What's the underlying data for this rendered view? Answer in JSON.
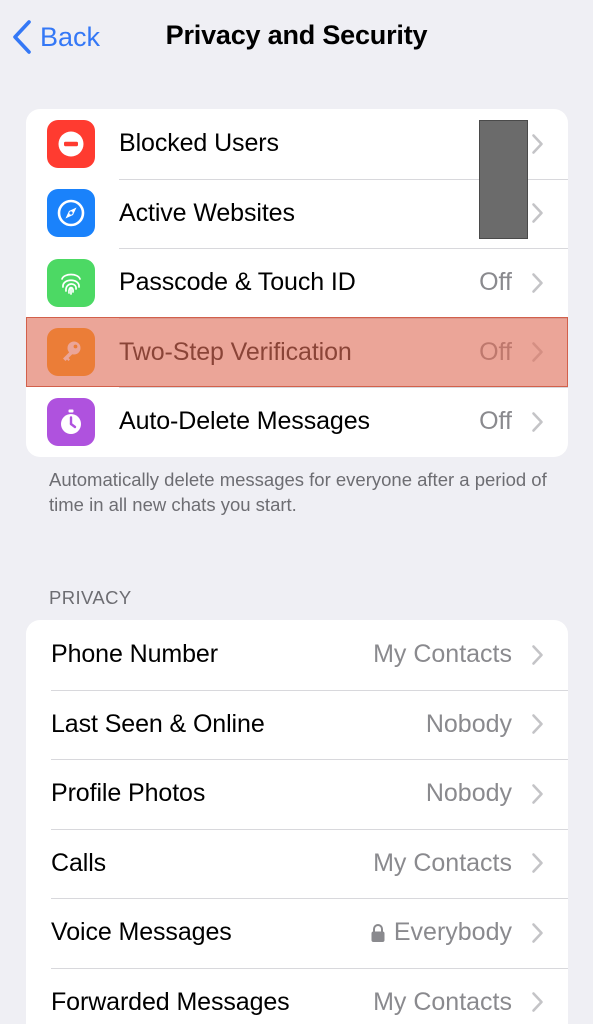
{
  "nav": {
    "back_label": "Back",
    "title": "Privacy and Security"
  },
  "security": {
    "items": [
      {
        "label": "Blocked Users",
        "value": "",
        "icon": "minus-circle-icon",
        "color": "#ff3b30"
      },
      {
        "label": "Active Websites",
        "value": "",
        "icon": "compass-icon",
        "color": "#1a82fb"
      },
      {
        "label": "Passcode & Touch ID",
        "value": "Off",
        "icon": "fingerprint-icon",
        "color": "#4cd964"
      },
      {
        "label": "Two-Step Verification",
        "value": "Off",
        "icon": "key-icon",
        "color": "#ff9500"
      },
      {
        "label": "Auto-Delete Messages",
        "value": "Off",
        "icon": "timer-icon",
        "color": "#af52de"
      }
    ],
    "footnote": "Automatically delete messages for everyone after a period of time in all new chats you start."
  },
  "privacy": {
    "header": "PRIVACY",
    "items": [
      {
        "label": "Phone Number",
        "value": "My Contacts"
      },
      {
        "label": "Last Seen & Online",
        "value": "Nobody"
      },
      {
        "label": "Profile Photos",
        "value": "Nobody"
      },
      {
        "label": "Calls",
        "value": "My Contacts"
      },
      {
        "label": "Voice Messages",
        "value": "Everybody",
        "locked": true
      },
      {
        "label": "Forwarded Messages",
        "value": "My Contacts"
      }
    ]
  },
  "colors": {
    "accent": "#3478f6",
    "highlight": "#df6e58",
    "secondary_text": "#8a8a8e",
    "background": "#efeff4"
  }
}
